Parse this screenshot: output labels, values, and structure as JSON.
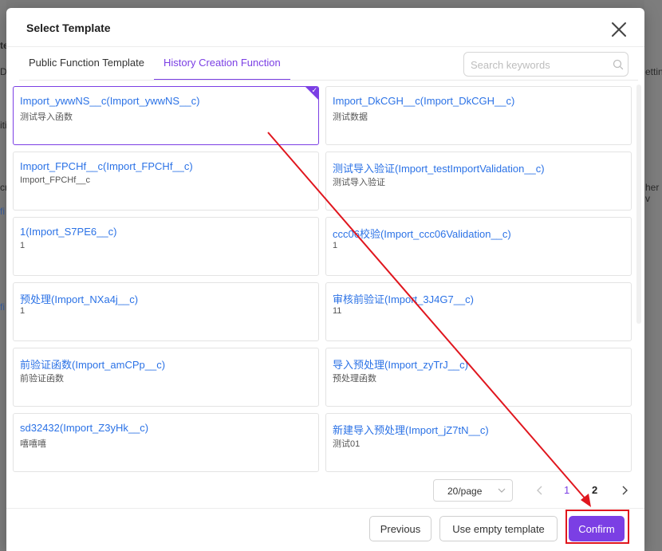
{
  "background": {
    "fragments": [
      "te",
      "D",
      "iti",
      "cr",
      "fi",
      "fi",
      "ettin",
      "her v"
    ]
  },
  "dialog": {
    "title": "Select Template",
    "close_icon": "close-icon"
  },
  "tabs": [
    {
      "label": "Public Function Template",
      "active": false
    },
    {
      "label": "History Creation Function",
      "active": true
    }
  ],
  "search": {
    "placeholder": "Search keywords",
    "value": "",
    "icon": "search-icon"
  },
  "cards": [
    {
      "name": "Import_ywwNS__c(Import_ywwNS__c)",
      "desc": "测试导入函数",
      "selected": true
    },
    {
      "name": "Import_DkCGH__c(Import_DkCGH__c)",
      "desc": "测试数据",
      "selected": false
    },
    {
      "name": "Import_FPCHf__c(Import_FPCHf__c)",
      "desc": "Import_FPCHf__c",
      "selected": false
    },
    {
      "name": "测试导入验证(Import_testImportValidation__c)",
      "desc": "测试导入验证",
      "selected": false
    },
    {
      "name": "1(Import_S7PE6__c)",
      "desc": "1",
      "selected": false
    },
    {
      "name": "ccc06校验(Import_ccc06Validation__c)",
      "desc": "1",
      "selected": false
    },
    {
      "name": "预处理(Import_NXa4j__c)",
      "desc": "1",
      "selected": false
    },
    {
      "name": "审核前验证(Import_3J4G7__c)",
      "desc": "11",
      "selected": false
    },
    {
      "name": "前验证函数(Import_amCPp__c)",
      "desc": "前验证函数",
      "selected": false
    },
    {
      "name": "导入预处理(Import_zyTrJ__c)",
      "desc": "预处理函数",
      "selected": false
    },
    {
      "name": "sd32432(Import_Z3yHk__c)",
      "desc": "嘻嘻嘻",
      "selected": false
    },
    {
      "name": "新建导入预处理(Import_jZ7tN__c)",
      "desc": "测试01",
      "selected": false
    }
  ],
  "pagination": {
    "page_size": "20/page",
    "pages": [
      "1",
      "2"
    ],
    "current_page": "1"
  },
  "footer": {
    "previous_label": "Previous",
    "empty_label": "Use empty template",
    "confirm_label": "Confirm"
  },
  "colors": {
    "accent": "#7b3fe4",
    "link": "#2b72e6",
    "annotation": "#e0161e"
  }
}
